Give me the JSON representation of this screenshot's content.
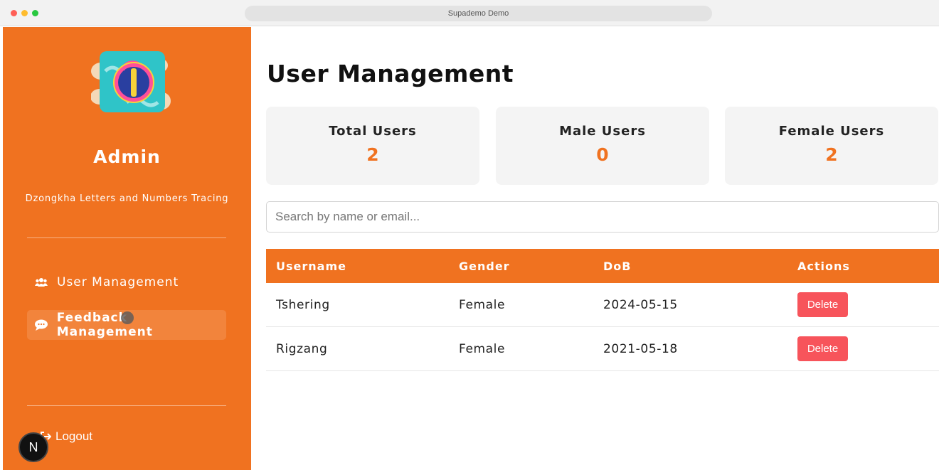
{
  "window": {
    "title": "Supademo Demo"
  },
  "sidebar": {
    "role_title": "Admin",
    "app_subtitle": "Dzongkha Letters and Numbers Tracing",
    "nav": [
      {
        "label": "User Management",
        "icon": "users-icon",
        "active": false
      },
      {
        "label": "Feedback Management",
        "icon": "comment-icon",
        "active": true
      }
    ],
    "logout_label": "Logout",
    "badge": "N"
  },
  "main": {
    "page_title": "User Management",
    "stats": [
      {
        "label": "Total Users",
        "value": "2"
      },
      {
        "label": "Male Users",
        "value": "0"
      },
      {
        "label": "Female Users",
        "value": "2"
      }
    ],
    "search_placeholder": "Search by name or email...",
    "table": {
      "headers": [
        "Username",
        "Gender",
        "DoB",
        "Actions"
      ],
      "rows": [
        {
          "username": "Tshering",
          "gender": "Female",
          "dob": "2024-05-15",
          "action": "Delete"
        },
        {
          "username": "Rigzang",
          "gender": "Female",
          "dob": "2021-05-18",
          "action": "Delete"
        }
      ]
    }
  },
  "colors": {
    "accent": "#f07220",
    "danger": "#f7545b",
    "card_bg": "#f4f4f4"
  }
}
